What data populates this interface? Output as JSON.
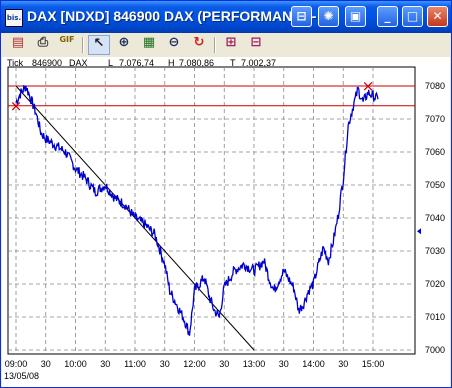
{
  "window": {
    "title": "DAX [NDXD]  846900  DAX (PERFORMANCE-",
    "app_icon_text": "bis.",
    "title_buttons": [
      {
        "name": "tile-windows-button",
        "glyph": "⊟"
      },
      {
        "name": "settings-button",
        "glyph": "✺"
      },
      {
        "name": "picture-button",
        "glyph": "▣"
      },
      {
        "name": "minimize-button",
        "glyph": "_"
      },
      {
        "name": "maximize-button",
        "glyph": "□"
      },
      {
        "name": "close-button",
        "glyph": "✕"
      }
    ]
  },
  "toolbar": {
    "tools": [
      {
        "name": "properties-icon",
        "glyph": "▤",
        "color": "#b03030"
      },
      {
        "name": "print-icon",
        "glyph": "⎙",
        "color": "#404040"
      },
      {
        "name": "export-gif-icon",
        "glyph": "GIF",
        "color": "#806000"
      },
      {
        "name": "pointer-icon",
        "glyph": "↖",
        "color": "#202020"
      },
      {
        "name": "zoom-in-icon",
        "glyph": "⊕",
        "color": "#203060"
      },
      {
        "name": "chart-frame-icon",
        "glyph": "▦",
        "color": "#207020"
      },
      {
        "name": "zoom-out-icon",
        "glyph": "⊖",
        "color": "#203060"
      },
      {
        "name": "refresh-icon",
        "glyph": "↻",
        "color": "#d02020"
      },
      {
        "name": "indicator-add-icon",
        "glyph": "⊞",
        "color": "#a02060"
      },
      {
        "name": "indicator-remove-icon",
        "glyph": "⊟",
        "color": "#a02060"
      }
    ]
  },
  "info_bar": {
    "items": [
      "Tick",
      "846900",
      "DAX",
      "L",
      "7.076,74",
      "H",
      "7.080,86",
      "T",
      "7.002,37"
    ]
  },
  "chart_data": {
    "type": "line",
    "date_label": "13/05/08",
    "x_ticks": [
      "09:00",
      "30",
      "10:00",
      "30",
      "11:00",
      "30",
      "12:00",
      "30",
      "13:00",
      "30",
      "14:00",
      "30",
      "15:00"
    ],
    "y_ticks": [
      "7080",
      "7070",
      "7060",
      "7050",
      "7040",
      "7030",
      "7020",
      "7010",
      "7000"
    ],
    "ylim": [
      7000,
      7080
    ],
    "grid": true,
    "grid_style": "dashed",
    "series": [
      {
        "color": "#0000cc",
        "x": [
          "09:00",
          "09:05",
          "09:10",
          "09:15",
          "09:20",
          "09:25",
          "09:30",
          "09:40",
          "09:50",
          "10:00",
          "10:10",
          "10:20",
          "10:30",
          "10:40",
          "10:50",
          "11:00",
          "11:10",
          "11:20",
          "11:30",
          "11:35",
          "11:40",
          "11:45",
          "11:50",
          "11:55",
          "12:00",
          "12:05",
          "12:10",
          "12:15",
          "12:20",
          "12:25",
          "12:30",
          "12:40",
          "12:50",
          "13:00",
          "13:10",
          "13:15",
          "13:20",
          "13:30",
          "13:40",
          "13:45",
          "13:50",
          "13:55",
          "14:00",
          "14:05",
          "14:10",
          "14:15",
          "14:20",
          "14:25",
          "14:30",
          "14:35",
          "14:40",
          "14:45",
          "14:50",
          "14:55",
          "15:00",
          "15:05"
        ],
        "values": [
          7075,
          7078,
          7080,
          7076,
          7072,
          7066,
          7064,
          7062,
          7060,
          7055,
          7052,
          7048,
          7050,
          7046,
          7044,
          7040,
          7038,
          7035,
          7026,
          7018,
          7015,
          7012,
          7009,
          7005,
          7018,
          7020,
          7022,
          7016,
          7012,
          7010,
          7019,
          7024,
          7026,
          7024,
          7027,
          7022,
          7018,
          7024,
          7019,
          7012,
          7014,
          7018,
          7020,
          7026,
          7031,
          7027,
          7033,
          7041,
          7052,
          7068,
          7074,
          7079,
          7075,
          7078,
          7077,
          7076
        ]
      }
    ],
    "trendline": {
      "color": "#000000",
      "x": [
        "09:00",
        "13:00"
      ],
      "values": [
        7080,
        7000
      ]
    },
    "horizontal_lines": [
      {
        "value": 7080,
        "color": "#cc0000"
      },
      {
        "value": 7074,
        "color": "#cc0000"
      }
    ],
    "markers": [
      {
        "x": "09:00",
        "value": 7074,
        "color": "#cc0000",
        "glyph": "×"
      },
      {
        "x": "14:55",
        "value": 7080,
        "color": "#cc0000",
        "glyph": "×"
      }
    ],
    "right_pointer": {
      "value": 7036,
      "color": "#0000cc"
    }
  }
}
